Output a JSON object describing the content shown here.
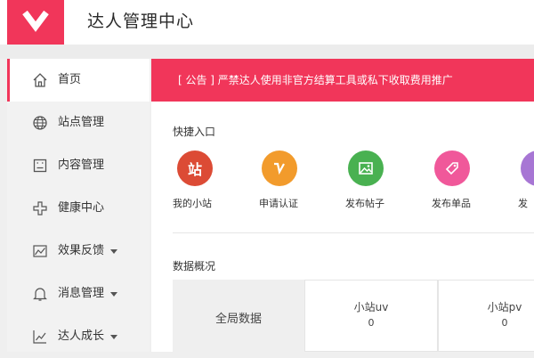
{
  "header": {
    "title": "达人管理中心"
  },
  "sidebar": {
    "items": [
      {
        "label": "首页",
        "icon": "home-icon",
        "active": true
      },
      {
        "label": "站点管理",
        "icon": "globe-icon"
      },
      {
        "label": "内容管理",
        "icon": "document-icon"
      },
      {
        "label": "健康中心",
        "icon": "plus-icon"
      },
      {
        "label": "效果反馈",
        "icon": "chart-icon",
        "has_dropdown": true
      },
      {
        "label": "消息管理",
        "icon": "bell-icon",
        "has_dropdown": true
      },
      {
        "label": "达人成长",
        "icon": "growth-icon",
        "has_dropdown": true
      }
    ]
  },
  "notice": {
    "text": "[ 公告 ] 严禁达人使用非官方结算工具或私下收取费用推广"
  },
  "shortcuts": {
    "title": "快捷入口",
    "items": [
      {
        "label": "我的小站",
        "icon_text": "站",
        "color": "#dc4b35"
      },
      {
        "label": "申请认证",
        "icon": "v-icon",
        "color": "#f29b2c"
      },
      {
        "label": "发布帖子",
        "icon": "picture-icon",
        "color": "#49b151"
      },
      {
        "label": "发布单品",
        "icon": "tag-icon",
        "color": "#f0589a"
      },
      {
        "label": "发",
        "icon": "partial-icon",
        "color": "#a776d4"
      }
    ]
  },
  "overview": {
    "title": "数据概况",
    "cells": [
      {
        "title": "全局数据"
      },
      {
        "title": "小站uv",
        "value": "0"
      },
      {
        "title": "小站pv",
        "value": "0"
      }
    ]
  },
  "colors": {
    "accent": "#f1365a"
  }
}
